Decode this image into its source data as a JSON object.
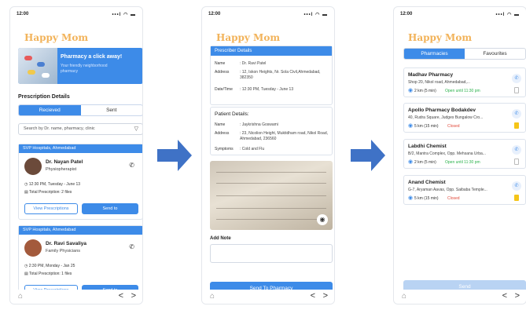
{
  "common": {
    "time": "12:00",
    "signal": "•••l ◠ ▬",
    "brand": "Happy Mom",
    "prev": "<",
    "next": ">"
  },
  "colors": {
    "primary": "#3d8be8",
    "brand": "#f2b35a",
    "open": "#2bb24c",
    "closed": "#e14a3b",
    "arrow": "#3f72c6"
  },
  "screen1": {
    "banner_title": "Pharmacy a click away!",
    "banner_sub": "Your friendly neighborhood pharmacy",
    "section_title": "Prescription Details",
    "tabs": [
      "Recieved",
      "Sent"
    ],
    "search_placeholder": "Search by Dr. name, pharmacy, clinic",
    "cards": [
      {
        "hospital": "SVP Hospitals, Ahmedabad",
        "doctor": "Dr. Nayan Patel",
        "role": "Physiopherapist",
        "time": "12:30 PM, Tuesday - June 13",
        "total": "Total Prescription: 2 files",
        "view": "View Prescriptions",
        "send": "Send to"
      },
      {
        "hospital": "SVP Hospitals, Ahmedabad",
        "doctor": "Dr. Ravi Savaliya",
        "role": "Family Physicians",
        "time": "2:30 PM, Monday - Jan 25",
        "total": "Total Prescription: 1 files",
        "view": "View Prescriptions",
        "send": "Send to"
      }
    ]
  },
  "screen2": {
    "prescriber_header": "Prescriber Details",
    "prescriber": [
      {
        "k": "Name",
        "v": ": Dr. Ravi Patel"
      },
      {
        "k": "Address",
        "v": ": 12, Iskon Heights, Nr. Sola Civil,Ahmedabad, 382350"
      },
      {
        "k": "Date/Time",
        "v": ": 12:30 PM, Tuesday - June 13"
      }
    ],
    "patient_title": "Patient Details:",
    "patient": [
      {
        "k": "Name",
        "v": ": Jaykrishna Goswami"
      },
      {
        "k": "Address",
        "v": ": 23, Nicolion Height, Muktidham road, Nikol Road, Ahmedabad, 236560"
      },
      {
        "k": "Symptoms",
        "v": ": Cold and Flu"
      }
    ],
    "add_note": "Add Note",
    "send_button": "Send To Pharmacy"
  },
  "screen3": {
    "tabs": [
      "Pharmacies",
      "Favourites"
    ],
    "pharmacies": [
      {
        "name": "Madhav Pharmacy",
        "address": "Shop 20, Nikol road, Ahmedabad,...",
        "distance": "2 km (5 min)",
        "status": "Open until 11:30 pm",
        "open": true,
        "fav": false
      },
      {
        "name": "Apollo Pharmacy Bodakdev",
        "address": "40, Rudra Square, Judges Bungalow Cro...",
        "distance": "5 km (15 min)",
        "status": "Closed",
        "open": false,
        "fav": true
      },
      {
        "name": "Labdhi Chemist",
        "address": "B/2, Mantra Complex, Opp. Mehsana Urba...",
        "distance": "2 km (5 min)",
        "status": "Open until 11:30 pm",
        "open": true,
        "fav": false
      },
      {
        "name": "Anand Chemist",
        "address": "G-7, Aryaman Aavas, Opp. Saibaba Temple...",
        "distance": "5 km (15 min)",
        "status": "Closed",
        "open": false,
        "fav": true
      }
    ],
    "send_button": "Send"
  }
}
